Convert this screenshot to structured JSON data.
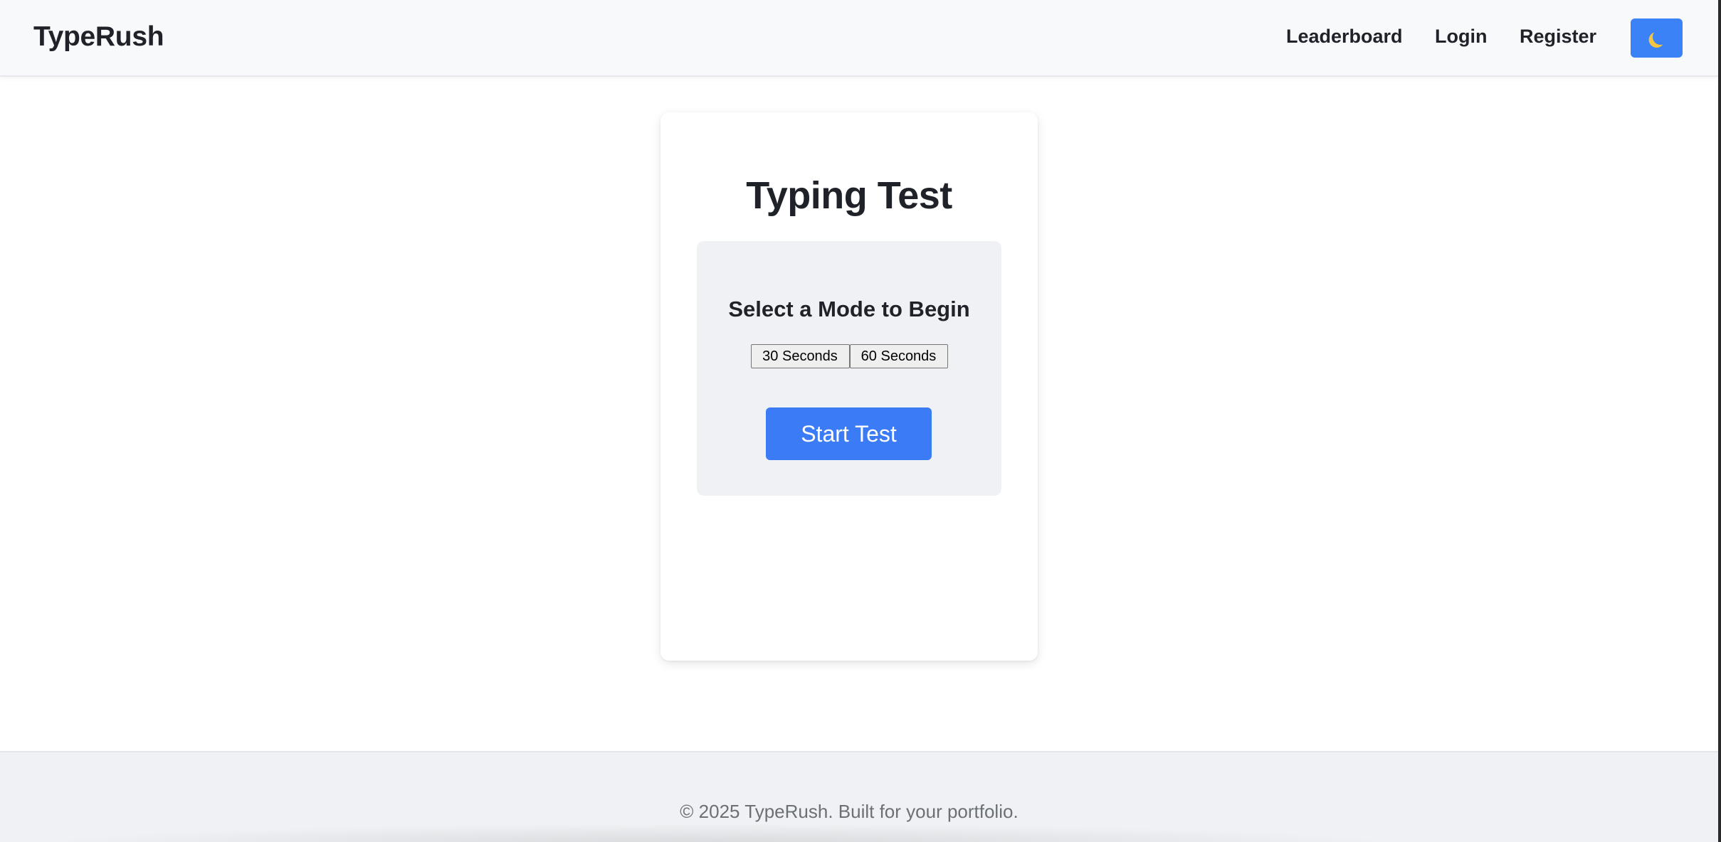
{
  "header": {
    "brand": "TypeRush",
    "nav": {
      "leaderboard": "Leaderboard",
      "login": "Login",
      "register": "Register"
    },
    "theme_toggle_icon": "moon-icon"
  },
  "main": {
    "title": "Typing Test",
    "mode_panel": {
      "heading": "Select a Mode to Begin",
      "modes": [
        "30 Seconds",
        "60 Seconds"
      ],
      "start_label": "Start Test"
    }
  },
  "footer": {
    "text": "© 2025 TypeRush. Built for your portfolio."
  },
  "colors": {
    "accent": "#3b82f6",
    "navbar_bg": "#f8f9fa",
    "panel_bg": "#f0f1f4",
    "text": "#1f2329",
    "footer_text": "#6b7076"
  }
}
